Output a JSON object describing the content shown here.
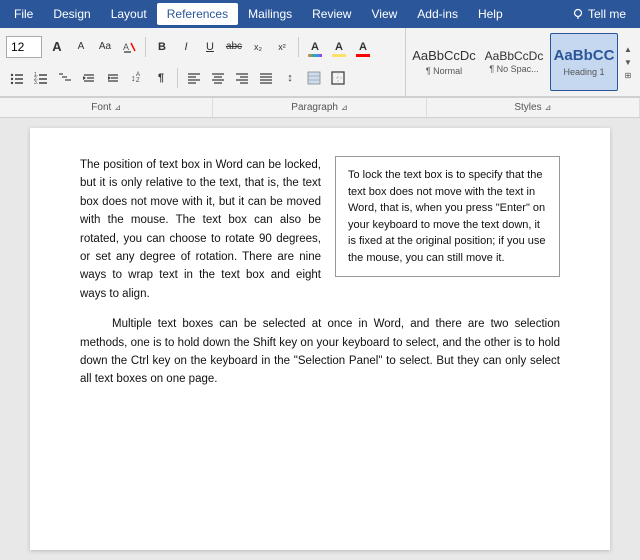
{
  "menubar": {
    "items": [
      {
        "label": "File",
        "id": "file"
      },
      {
        "label": "Design",
        "id": "design"
      },
      {
        "label": "Layout",
        "id": "layout"
      },
      {
        "label": "References",
        "id": "references",
        "active": true
      },
      {
        "label": "Mailings",
        "id": "mailings"
      },
      {
        "label": "Review",
        "id": "review"
      },
      {
        "label": "View",
        "id": "view"
      },
      {
        "label": "Add-ins",
        "id": "addins"
      },
      {
        "label": "Help",
        "id": "help"
      },
      {
        "label": "Tell me",
        "id": "tellme"
      }
    ]
  },
  "toolbar": {
    "font_size": "12",
    "font_size_placeholder": "12",
    "grow_icon": "A",
    "shrink_icon": "A",
    "case_icon": "Aa",
    "clear_format_icon": "🖉",
    "bullets_icon": "≡",
    "numbering_icon": "≡",
    "multilevel_icon": "≡",
    "decrease_indent_icon": "⇤",
    "increase_indent_icon": "⇥",
    "sort_icon": "↕",
    "show_formatting_icon": "¶",
    "align_left_icon": "☰",
    "align_center_icon": "☰",
    "align_right_icon": "☰",
    "justify_icon": "☰",
    "line_spacing_icon": "↕",
    "shading_icon": "▦",
    "border_icon": "▢",
    "bold_label": "B",
    "italic_label": "I",
    "underline_label": "U",
    "strikethrough_label": "abc",
    "subscript_label": "x₂",
    "superscript_label": "x²",
    "font_color_label": "A",
    "highlight_label": "A",
    "text_effects_label": "A"
  },
  "styles": {
    "items": [
      {
        "id": "normal",
        "preview": "AaBbCcDc",
        "label": "¶ Normal",
        "selected": false
      },
      {
        "id": "no-spacing",
        "preview": "AaBbCcDc",
        "label": "¶ No Spac...",
        "selected": false
      },
      {
        "id": "heading1",
        "preview": "AaBbCC",
        "label": "Heading 1",
        "selected": false,
        "heading": true
      }
    ]
  },
  "section_labels": {
    "font": "Font",
    "paragraph": "Paragraph",
    "styles": "Styles"
  },
  "document": {
    "paragraph1": "The position of text box in Word can be locked, but it is only relative to the text, that is, the text box does not move with it, but it can be moved with the mouse. The text box can also be rotated, you can choose to rotate 90 degrees, or set any degree of rotation. There are nine ways to wrap text in the text box and eight ways to align.",
    "paragraph2": "Multiple text boxes can be selected at once in Word, and there are two selection methods, one is to hold down the Shift key on your keyboard to select, and the other is to hold down the Ctrl key on the keyboard in the \"Selection Panel\" to select. But they can only select all text boxes on one page.",
    "textbox": "To lock the text box is to specify that the text box does not move with the text in Word, that is, when you press \"Enter\" on your keyboard to move the text down, it is fixed at the original position; if you use the mouse, you can still move it."
  },
  "cursor": {
    "style_hover": "Heading 1"
  }
}
